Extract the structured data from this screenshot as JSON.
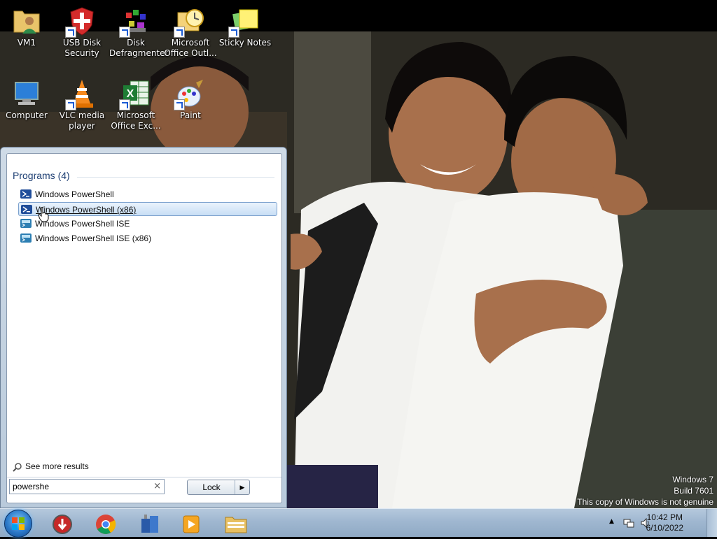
{
  "desktop_icons": [
    {
      "name": "vm1",
      "label_line1": "VM1",
      "label_line2": ""
    },
    {
      "name": "usb-disk-security",
      "label_line1": "USB Disk",
      "label_line2": "Security"
    },
    {
      "name": "disk-defragmenter",
      "label_line1": "Disk",
      "label_line2": "Defragmenter"
    },
    {
      "name": "microsoft-office-outlook",
      "label_line1": "Microsoft",
      "label_line2": "Office Outl..."
    },
    {
      "name": "sticky-notes",
      "label_line1": "Sticky Notes",
      "label_line2": ""
    },
    {
      "name": "computer",
      "label_line1": "Computer",
      "label_line2": ""
    },
    {
      "name": "vlc-media-player",
      "label_line1": "VLC media",
      "label_line2": "player"
    },
    {
      "name": "microsoft-office-excel",
      "label_line1": "Microsoft",
      "label_line2": "Office Exc..."
    },
    {
      "name": "paint",
      "label_line1": "Paint",
      "label_line2": ""
    }
  ],
  "start_menu": {
    "programs_header": "Programs (4)",
    "programs": [
      {
        "label": "Windows PowerShell",
        "icon": "powershell-icon",
        "selected": false
      },
      {
        "label": "Windows PowerShell (x86)",
        "icon": "powershell-icon",
        "selected": true
      },
      {
        "label": "Windows PowerShell ISE",
        "icon": "powershell-ise-icon",
        "selected": false
      },
      {
        "label": "Windows PowerShell ISE (x86)",
        "icon": "powershell-ise-icon",
        "selected": false
      }
    ],
    "see_more": "See more results",
    "search_value": "powershe",
    "search_clear": "×",
    "lock_label": "Lock",
    "lock_arrow": "▶"
  },
  "taskbar": {
    "pinned": [
      "start-orb-icon",
      "security-app-icon",
      "chrome-icon",
      "network-app-icon",
      "media-player-icon",
      "windows-explorer-icon"
    ],
    "clock_time": "10:42 PM",
    "clock_date": "6/10/2022",
    "tray_arrow": "▲"
  },
  "watermark": {
    "line1": "Windows 7",
    "line2": "Build 7601",
    "line3": "This copy of Windows is not genuine"
  },
  "colors": {
    "taskbar": "#9fb7d0",
    "selection": "#c8def5",
    "programs_header": "#1e3f73"
  }
}
